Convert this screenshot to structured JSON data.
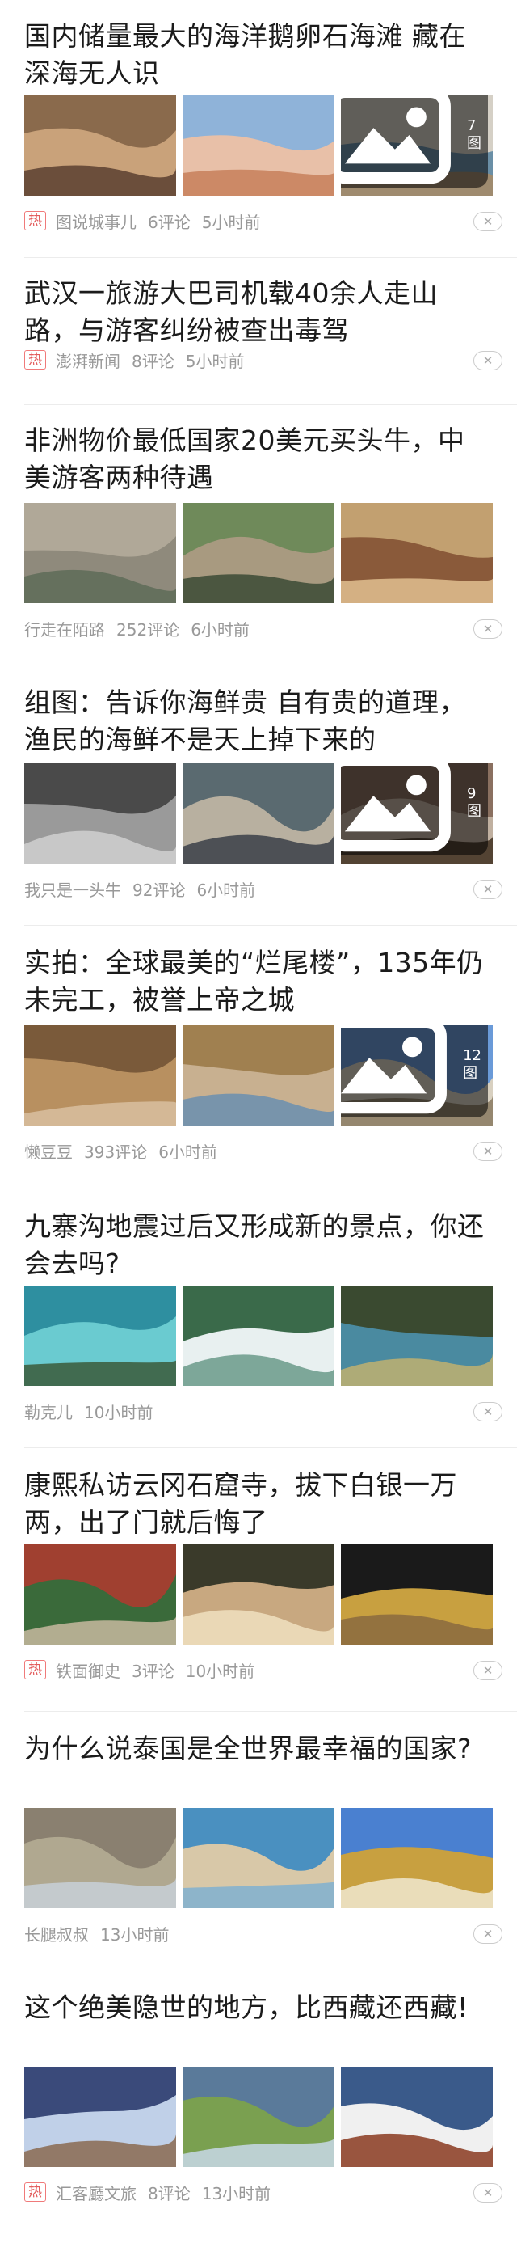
{
  "feed": {
    "hot_label": "热",
    "items": [
      {
        "title": "国内储量最大的海洋鹅卵石海滩 藏在深海无人识",
        "hot": true,
        "source": "图说城事儿",
        "comments": "6评论",
        "time": "5小时前",
        "pics": 3,
        "count": "7图"
      },
      {
        "title": "武汉一旅游大巴司机载40余人走山路，与游客纠纷被查出毒驾",
        "hot": true,
        "source": "澎湃新闻",
        "comments": "8评论",
        "time": "5小时前",
        "pics": 0,
        "count": ""
      },
      {
        "title": "非洲物价最低国家20美元买头牛，中美游客两种待遇",
        "hot": false,
        "source": "行走在陌路",
        "comments": "252评论",
        "time": "6小时前",
        "pics": 3,
        "count": ""
      },
      {
        "title": "组图：告诉你海鲜贵 自有贵的道理，渔民的海鲜不是天上掉下来的",
        "hot": false,
        "source": "我只是一头牛",
        "comments": "92评论",
        "time": "6小时前",
        "pics": 3,
        "count": "9图"
      },
      {
        "title": "实拍：全球最美的“烂尾楼”，135年仍未完工，被誉上帝之城",
        "hot": false,
        "source": "懒豆豆",
        "comments": "393评论",
        "time": "6小时前",
        "pics": 3,
        "count": "12图"
      },
      {
        "title": "九寨沟地震过后又形成新的景点，你还会去吗?",
        "hot": false,
        "source": "勒克儿",
        "comments": "",
        "time": "10小时前",
        "pics": 3,
        "count": ""
      },
      {
        "title": "康熙私访云冈石窟寺，拔下白银一万两，出了门就后悔了",
        "hot": true,
        "source": "铁面御史",
        "comments": "3评论",
        "time": "10小时前",
        "pics": 3,
        "count": ""
      },
      {
        "title": "为什么说泰国是全世界最幸福的国家?",
        "hot": false,
        "source": "长腿叔叔",
        "comments": "",
        "time": "13小时前",
        "pics": 3,
        "count": ""
      },
      {
        "title": "这个绝美隐世的地方，比西藏还西藏!",
        "hot": true,
        "source": "汇客廳文旅",
        "comments": "8评论",
        "time": "13小时前",
        "pics": 3,
        "count": ""
      }
    ]
  }
}
